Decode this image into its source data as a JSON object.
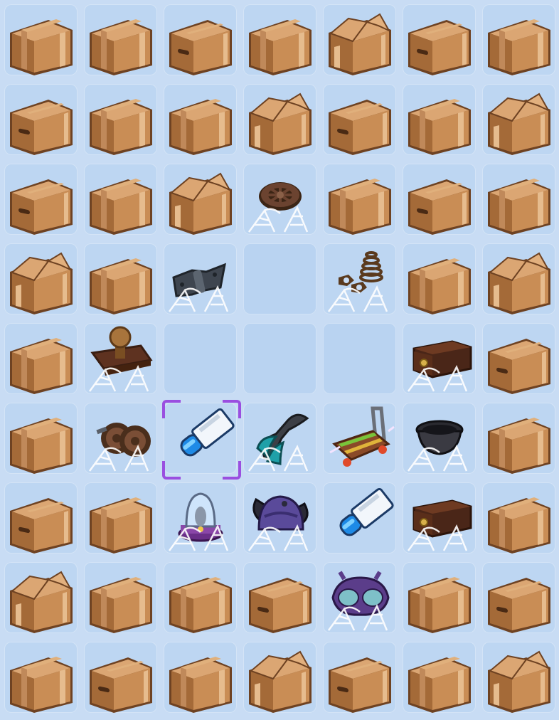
{
  "colors": {
    "board_bg": "#c8dcf4",
    "box": "#c98d55",
    "box_dark": "#a46a38",
    "box_outline": "#6e4222",
    "tape": "#e0b07c",
    "web": "#ffffff",
    "selection": "#9a4fe0"
  },
  "grid": {
    "columns": 7,
    "rows": 9,
    "cells": [
      [
        "box-tape",
        "box-tape",
        "box-handle",
        "box-tape",
        "box-open",
        "box-handle",
        "box-tape"
      ],
      [
        "box-handle",
        "box-tape",
        "box-tape",
        "box-open",
        "box-handle",
        "box-tape",
        "box-open"
      ],
      [
        "box-handle",
        "box-tape",
        "box-open",
        "wheel",
        "box-tape",
        "box-handle",
        "box-tape"
      ],
      [
        "box-open",
        "box-tape",
        "hinge",
        "empty",
        "nuts-spring",
        "box-tape",
        "box-open"
      ],
      [
        "box-tape",
        "stool",
        "empty",
        "empty",
        "empty",
        "drawer",
        "box-handle"
      ],
      [
        "box-tape",
        "wheels",
        "paint-tube",
        "pliers",
        "hand-truck",
        "pot",
        "box-tape"
      ],
      [
        "box-handle",
        "box-tape",
        "bell-jar",
        "viking-helmet",
        "paint-tube",
        "drawer",
        "box-tape"
      ],
      [
        "box-open",
        "box-tape",
        "box-tape",
        "box-handle",
        "goggles",
        "box-tape",
        "box-handle"
      ],
      [
        "box-tape",
        "box-handle",
        "box-tape",
        "box-open",
        "box-handle",
        "box-tape",
        "box-open"
      ]
    ],
    "webbed": [
      "2-3",
      "3-2",
      "3-4",
      "4-1",
      "4-5",
      "5-1",
      "5-3",
      "5-5",
      "6-2",
      "6-3",
      "6-5",
      "7-4"
    ],
    "selected": "5-2"
  }
}
